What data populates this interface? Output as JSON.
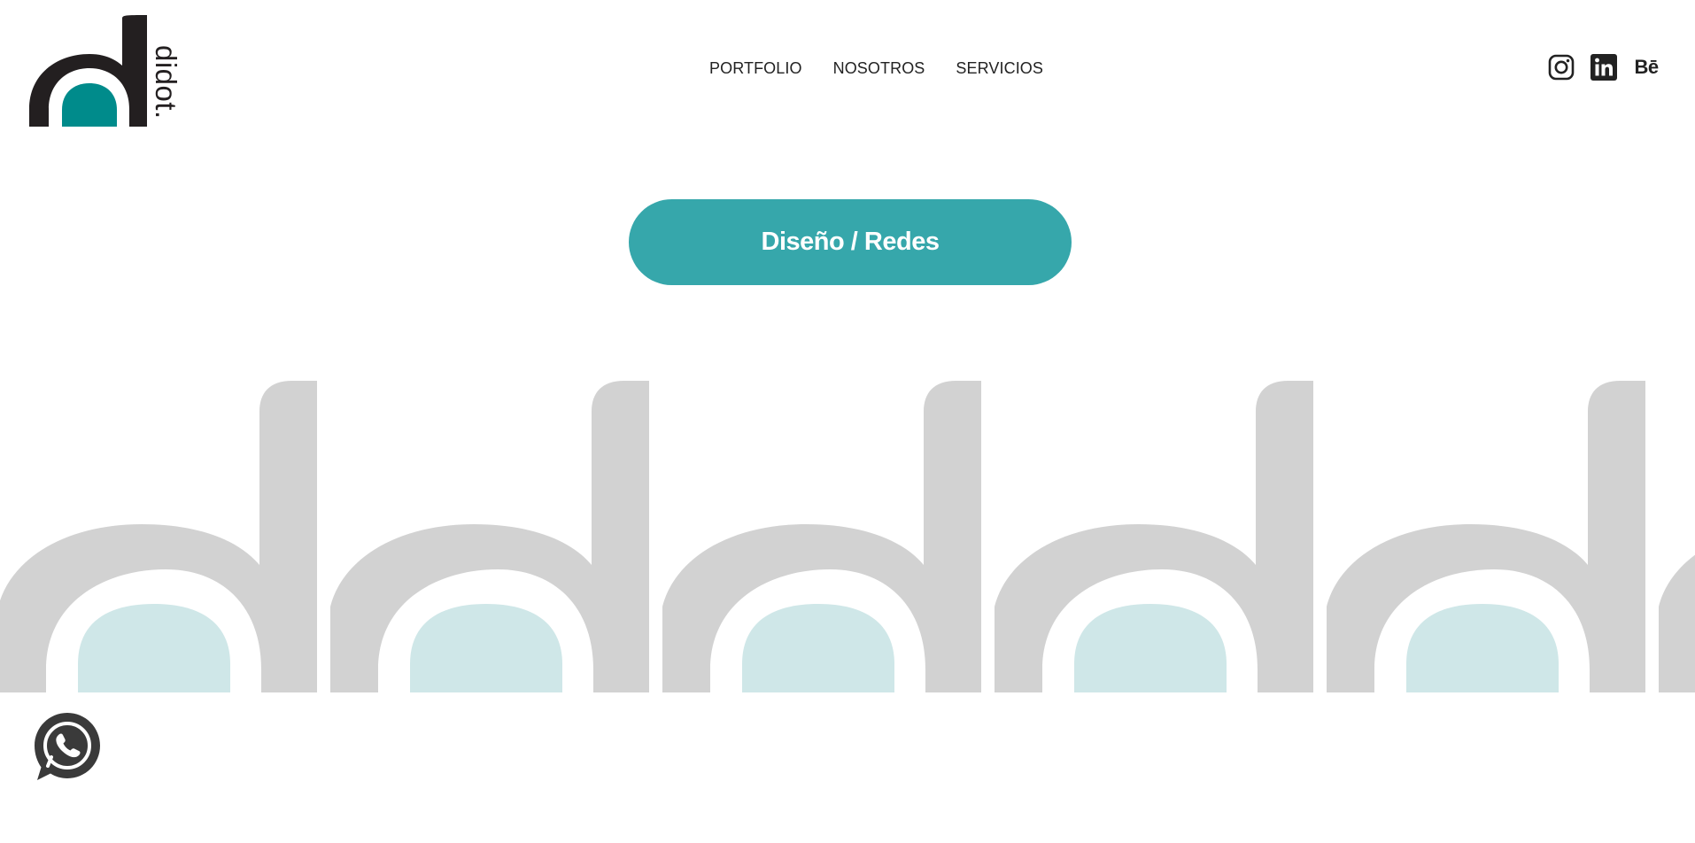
{
  "brand": {
    "name": "didot.",
    "logo_icon": "didot-d-logo",
    "colors": {
      "dark": "#231f20",
      "teal": "#008b8b",
      "button": "#36a7ab",
      "pattern_gray": "#d2d2d2",
      "pattern_teal_light": "#cfe7e8"
    }
  },
  "nav": {
    "items": [
      {
        "label": "PORTFOLIO"
      },
      {
        "label": "NOSOTROS"
      },
      {
        "label": "SERVICIOS"
      }
    ]
  },
  "social": {
    "instagram_icon": "instagram-icon",
    "linkedin_icon": "linkedin-icon",
    "behance_label": "Bē"
  },
  "hero": {
    "button_label": "Diseño / Redes"
  },
  "banner": {
    "pattern_icon": "repeating-d-letter-pattern"
  },
  "whatsapp": {
    "icon": "whatsapp-icon"
  }
}
